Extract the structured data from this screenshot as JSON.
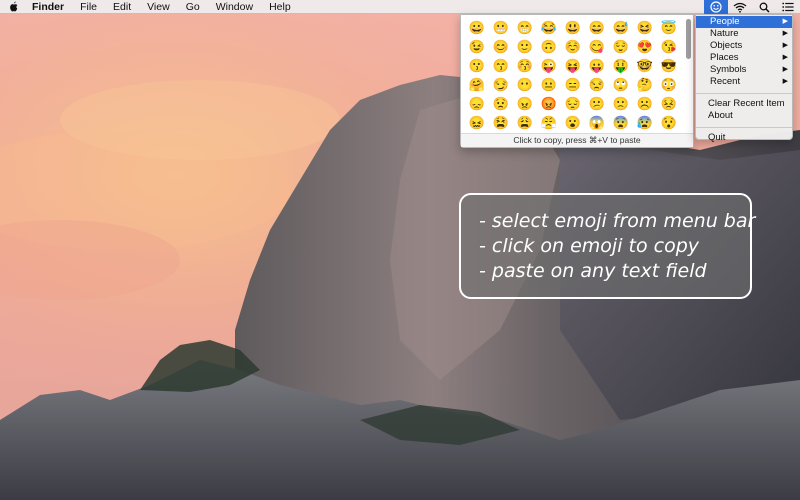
{
  "menubar": {
    "app_name": "Finder",
    "menus": [
      "File",
      "Edit",
      "View",
      "Go",
      "Window",
      "Help"
    ],
    "status_icons": [
      "emoji-smiley-icon",
      "wifi-icon",
      "search-icon",
      "list-icon"
    ]
  },
  "emoji_panel": {
    "emojis": [
      "😀",
      "😬",
      "😁",
      "😂",
      "😃",
      "😄",
      "😅",
      "😆",
      "😇",
      "😉",
      "😊",
      "🙂",
      "🙃",
      "☺️",
      "😋",
      "😌",
      "😍",
      "😘",
      "😗",
      "😙",
      "😚",
      "😜",
      "😝",
      "😛",
      "🤑",
      "🤓",
      "😎",
      "🤗",
      "😏",
      "😶",
      "😐",
      "😑",
      "😒",
      "🙄",
      "🤔",
      "😳",
      "😞",
      "😟",
      "😠",
      "😡",
      "😔",
      "😕",
      "🙁",
      "☹️",
      "😣",
      "😖",
      "😫",
      "😩",
      "😤",
      "😮",
      "😱",
      "😨",
      "😰",
      "😯",
      "😦",
      "😧",
      "😢",
      "😥",
      "😪",
      "😓",
      "😭",
      "😵",
      "😲",
      "🤐",
      "😷",
      "🤒",
      "🤕",
      "😴",
      "💤",
      "👿",
      "😈",
      "😺",
      "👹",
      "👺",
      "💩",
      "👻",
      "💀",
      "☠️",
      "👽",
      "👾",
      "🤖",
      "😸",
      "😹",
      "😻",
      "😼",
      "😽",
      "🙀",
      "😿",
      "😾",
      "🙌"
    ],
    "hint": "Click to copy, press ⌘+V to paste"
  },
  "dropdown": {
    "categories": [
      {
        "label": "People",
        "highlighted": true
      },
      {
        "label": "Nature",
        "highlighted": false
      },
      {
        "label": "Objects",
        "highlighted": false
      },
      {
        "label": "Places",
        "highlighted": false
      },
      {
        "label": "Symbols",
        "highlighted": false
      },
      {
        "label": "Recent",
        "highlighted": false
      }
    ],
    "clear_recent": "Clear Recent Item",
    "about": "About",
    "quit": "Quit"
  },
  "callout": {
    "lines": [
      "- select emoji from menu bar",
      "- click on emoji to copy",
      "- paste on any text field"
    ]
  },
  "colors": {
    "highlight": "#2f6fd8",
    "sky_top": "#f0b8a4",
    "sky_glow": "#f5c08a",
    "rock": "#6f6a6a"
  }
}
